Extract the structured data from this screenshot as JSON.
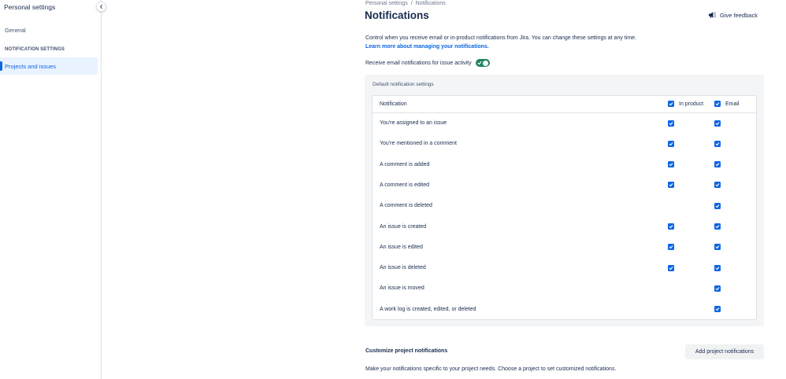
{
  "sidebar": {
    "title": "Personal settings",
    "general": "General",
    "section_label": "NOTIFICATION SETTINGS",
    "active_item": "Projects and issues"
  },
  "breadcrumb": {
    "parent": "Personal settings",
    "separator": "/",
    "current": "Notifications"
  },
  "header": {
    "title": "Notifications",
    "feedback_label": "Give feedback"
  },
  "description": {
    "text": "Control when you receive email or in-product notifications from Jira. You can change these settings at any time.",
    "link": "Learn more about managing your notifications."
  },
  "email_toggle": {
    "label": "Receive email notifications for issue activity",
    "enabled": true
  },
  "defaults_panel": {
    "title": "Default notification settings",
    "columns": {
      "notification": "Notification",
      "in_product": "In product",
      "email": "Email"
    },
    "rows": [
      {
        "label": "You're assigned to an issue",
        "in_product": true,
        "email": true
      },
      {
        "label": "You're mentioned in a comment",
        "in_product": true,
        "email": true
      },
      {
        "label": "A comment is added",
        "in_product": true,
        "email": true
      },
      {
        "label": "A comment is edited",
        "in_product": true,
        "email": true
      },
      {
        "label": "A comment is deleted",
        "in_product": false,
        "email": true
      },
      {
        "label": "An issue is created",
        "in_product": true,
        "email": true
      },
      {
        "label": "An issue is edited",
        "in_product": true,
        "email": true
      },
      {
        "label": "An issue is deleted",
        "in_product": true,
        "email": true
      },
      {
        "label": "An issue is moved",
        "in_product": false,
        "email": true
      },
      {
        "label": "A work log is created, edited, or deleted",
        "in_product": false,
        "email": true
      }
    ]
  },
  "customize": {
    "title": "Customize project notifications",
    "button": "Add project notifications",
    "description": "Make your notifications specific to your project needs. Choose a project to set customized notifications."
  },
  "colors": {
    "accent": "#0c66e4",
    "toggle_on": "#1f845a",
    "panel_bg": "#f4f5f7"
  }
}
